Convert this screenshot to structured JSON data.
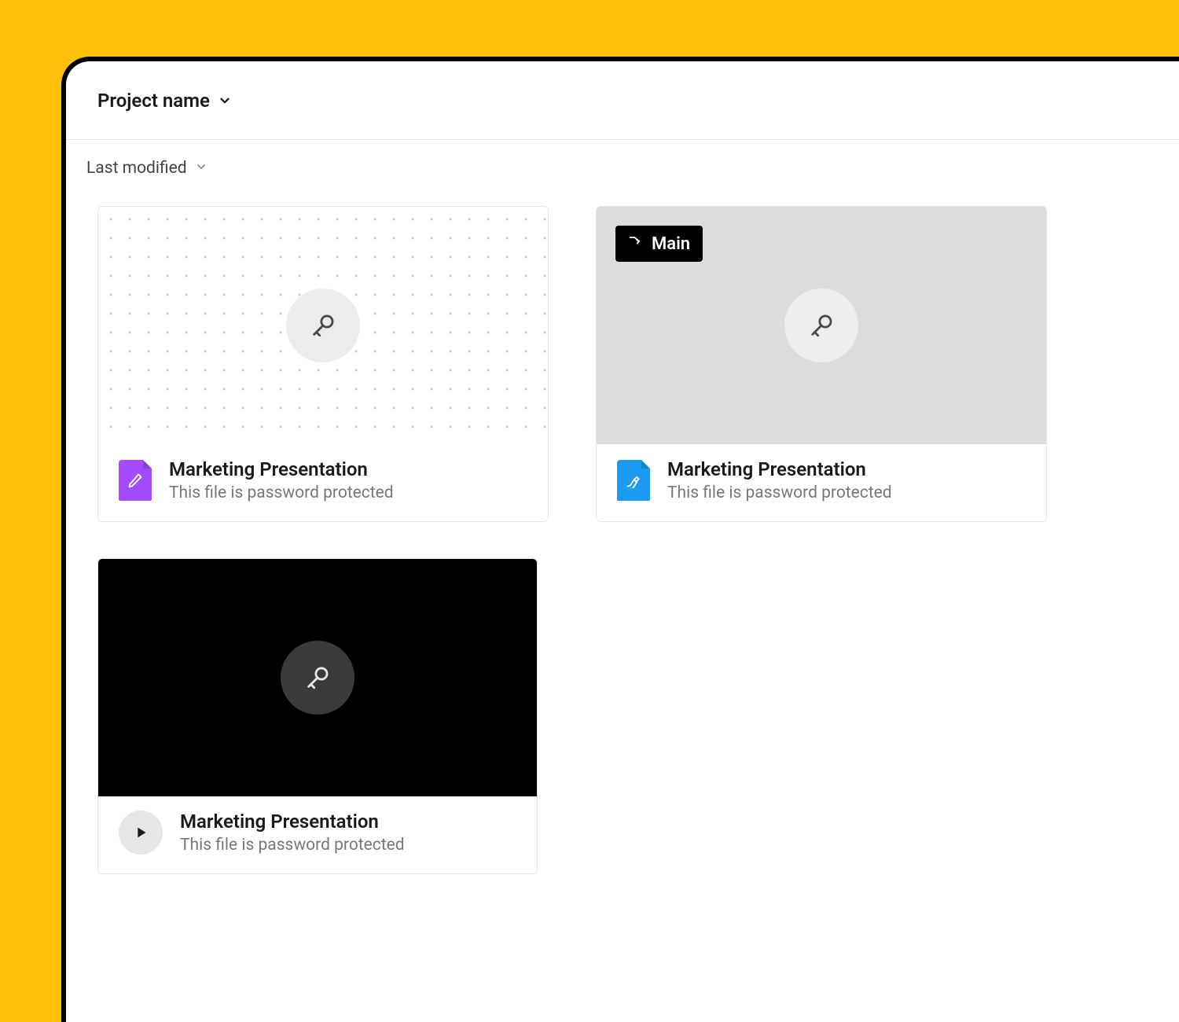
{
  "header": {
    "project_name": "Project name"
  },
  "sort": {
    "label": "Last modified"
  },
  "files": [
    {
      "title": "Marketing Presentation",
      "subtitle": "This file is password protected"
    },
    {
      "title": "Marketing Presentation",
      "subtitle": "This file is password protected",
      "branch": "Main"
    },
    {
      "title": "Marketing Presentation",
      "subtitle": "This file is password protected"
    }
  ]
}
